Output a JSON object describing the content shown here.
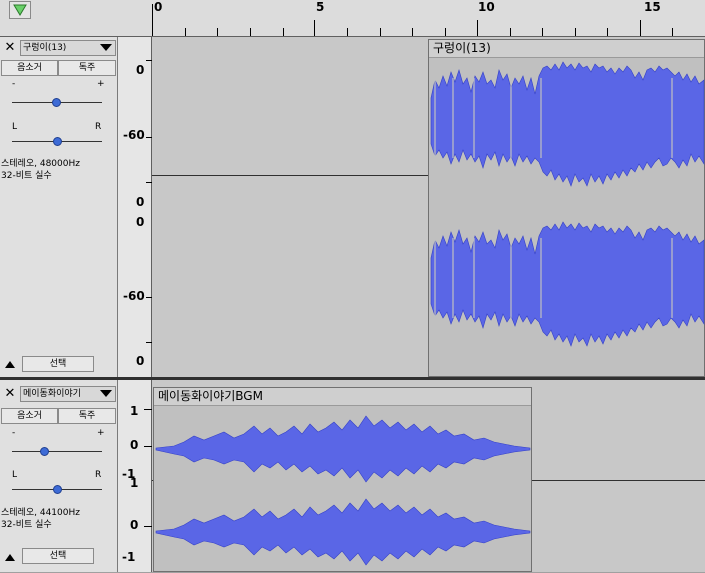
{
  "ruler": {
    "labels": [
      "0",
      "5",
      "10",
      "15"
    ]
  },
  "tracks": [
    {
      "name": "구렁이(13)",
      "mute_label": "음소거",
      "solo_label": "독주",
      "gain_minus": "-",
      "gain_plus": "+",
      "pan_left": "L",
      "pan_right": "R",
      "format_line1": "스테레오, 48000Hz",
      "format_line2": "32-비트 실수",
      "select_label": "선택",
      "clip_title": "구렁이(13)",
      "scale_top": "0",
      "scale_mid": "-60",
      "scale_bottom": "0",
      "scale2_top": "0",
      "scale2_mid": "-60",
      "scale2_bottom": "0"
    },
    {
      "name": "메이동화이야기",
      "mute_label": "음소거",
      "solo_label": "독주",
      "gain_minus": "-",
      "gain_plus": "+",
      "pan_left": "L",
      "pan_right": "R",
      "format_line1": "스테레오, 44100Hz",
      "format_line2": "32-비트 실수",
      "select_label": "선택",
      "clip_title": "메이동화이야기BGM",
      "scale_top": "1",
      "scale_mid": "0",
      "scale_bottom": "-1",
      "scale2_top": "1",
      "scale2_mid": "0",
      "scale2_bottom": "-1"
    }
  ],
  "colors": {
    "waveform": "#5060e0",
    "waveform_dark": "#3a46c8",
    "clip_bg": "#c0c0c0",
    "track_bg": "#c8c8c8"
  }
}
